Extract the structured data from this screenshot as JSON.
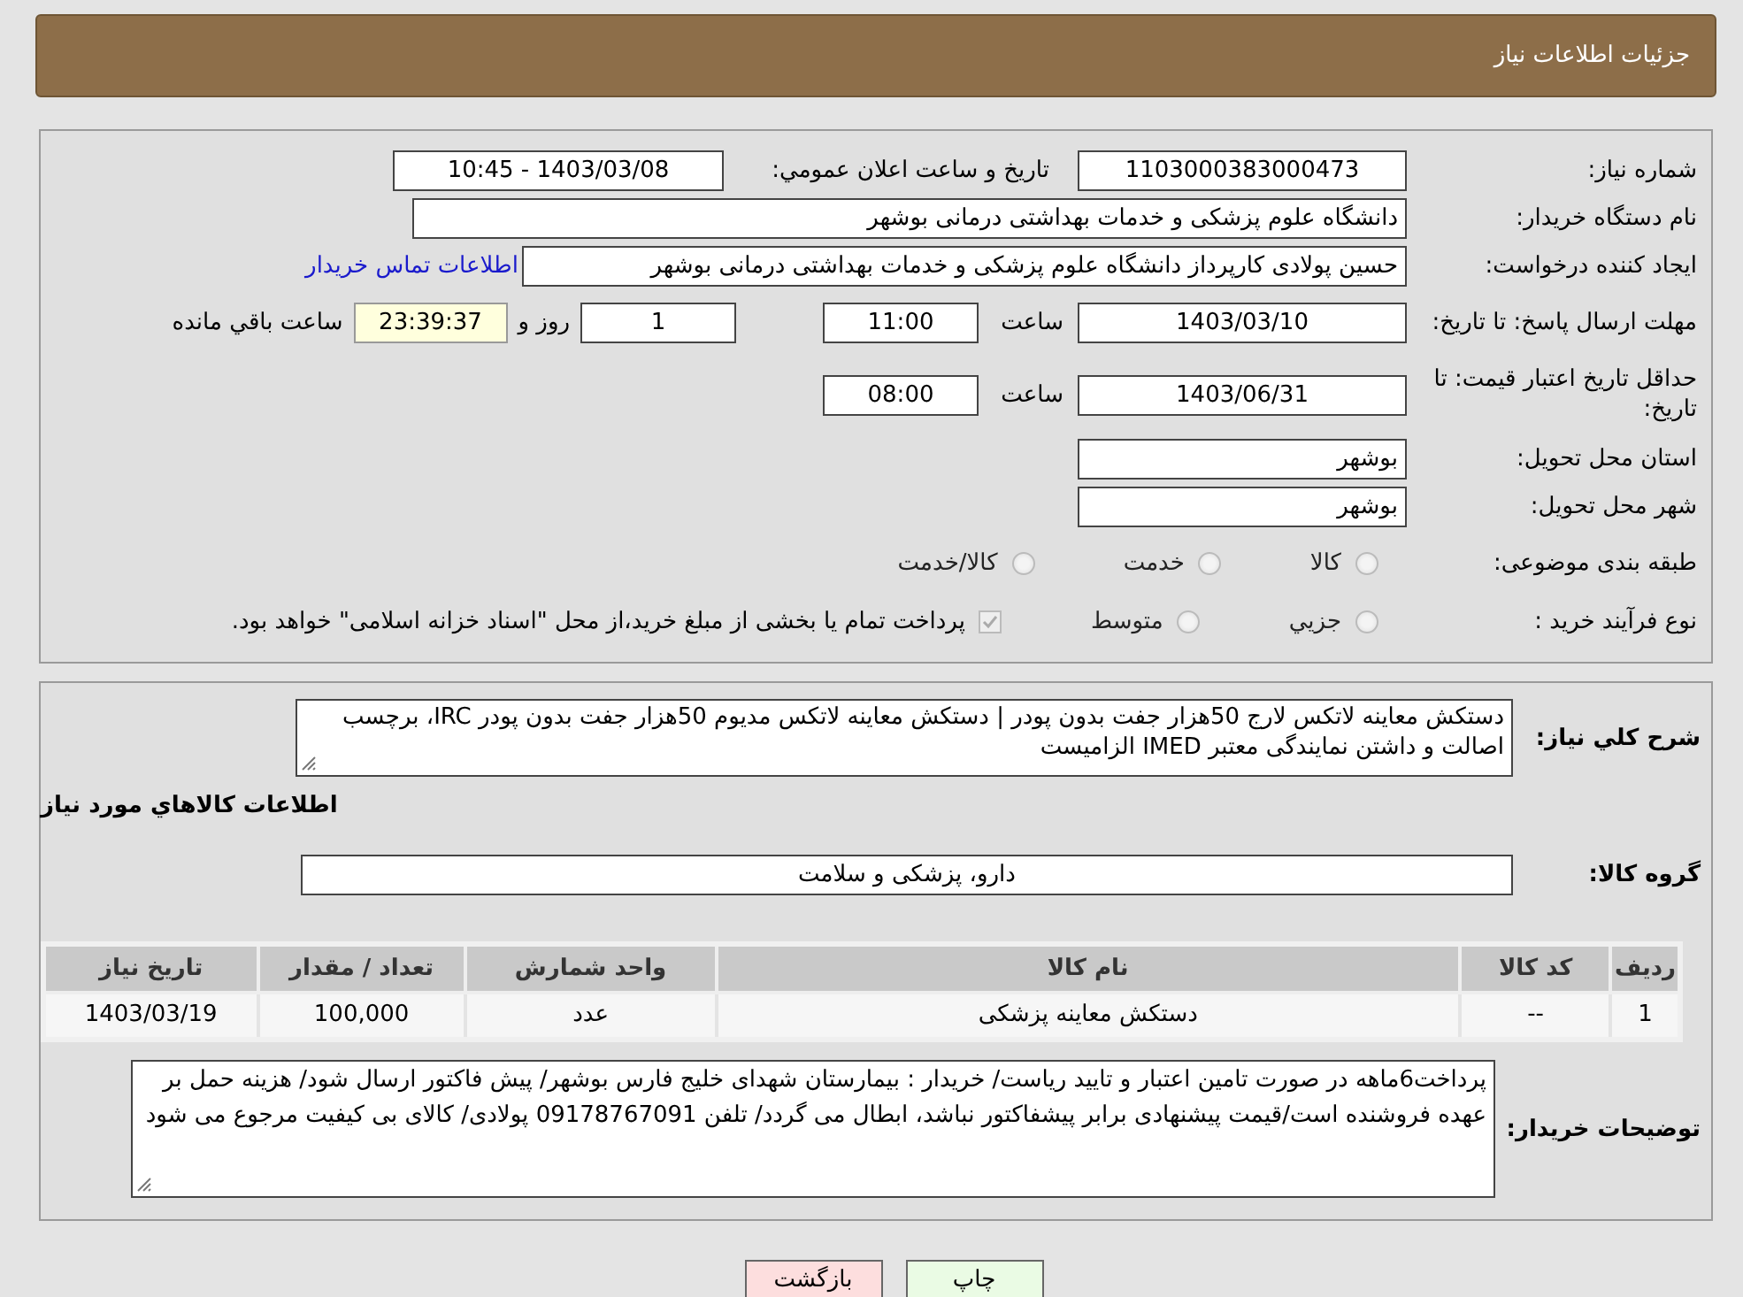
{
  "header": {
    "title": "جزئیات اطلاعات نیاز"
  },
  "details": {
    "need_number": {
      "label": "شماره نیاز:",
      "value": "1103000383000473"
    },
    "announce": {
      "label": "تاريخ و ساعت اعلان عمومي:",
      "value": "1403/03/08 - 10:45"
    },
    "buyer_org": {
      "label": "نام دستگاه خریدار:",
      "value": "دانشگاه علوم پزشکی و خدمات بهداشتی درمانی بوشهر"
    },
    "requester": {
      "label": "ایجاد کننده درخواست:",
      "value": "حسین پولادی کارپرداز دانشگاه علوم پزشکی و خدمات بهداشتی درمانی بوشهر",
      "link": "اطلاعات تماس خریدار"
    },
    "reply_deadline": {
      "label": "مهلت ارسال پاسخ: تا تاریخ:",
      "date": "1403/03/10",
      "time_label": "ساعت",
      "time": "11:00",
      "days": "1",
      "days_label": "روز و",
      "remaining": "23:39:37",
      "remaining_label": "ساعت باقي مانده"
    },
    "price_validity": {
      "label": "حداقل تاریخ اعتبار قیمت: تا تاریخ:",
      "date": "1403/06/31",
      "time_label": "ساعت",
      "time": "08:00"
    },
    "province": {
      "label": "استان محل تحویل:",
      "value": "بوشهر"
    },
    "city": {
      "label": "شهر محل تحویل:",
      "value": "بوشهر"
    },
    "category": {
      "label": "طبقه بندی موضوعی:",
      "options": [
        {
          "label": "کالا",
          "selected": false
        },
        {
          "label": "خدمت",
          "selected": false
        },
        {
          "label": "کالا/خدمت",
          "selected": false
        }
      ]
    },
    "process": {
      "label": "نوع فرآیند خرید :",
      "options": [
        {
          "label": "جزيي",
          "selected": false
        },
        {
          "label": "متوسط",
          "selected": false
        }
      ],
      "payment_note": {
        "label": "پرداخت تمام یا بخشی از مبلغ خرید،از محل \"اسناد خزانه اسلامی\" خواهد بود.",
        "checked": true
      }
    }
  },
  "items": {
    "summary": {
      "label": "شرح کلي نیاز:",
      "value": "دستکش معاینه لاتکس لارج 50هزار جفت بدون پودر | دستکش معاینه لاتکس مدیوم 50هزار جفت بدون پودر IRC، برچسب اصالت و داشتن نمایندگی معتبر IMED الزامیست"
    },
    "heading": "اطلاعات کالاهاي مورد نیاز",
    "group": {
      "label": "گروه کالا:",
      "value": "دارو، پزشکی و سلامت"
    },
    "table": {
      "columns": [
        "ردیف",
        "کد کالا",
        "نام کالا",
        "واحد شمارش",
        "تعداد / مقدار",
        "تاریخ نیاز"
      ],
      "rows": [
        [
          "1",
          "--",
          "دستکش معاینه پزشکی",
          "عدد",
          "100,000",
          "1403/03/19"
        ]
      ]
    },
    "notes": {
      "label": "توضیحات خریدار:",
      "value": "پرداخت6ماهه در صورت تامین اعتبار و تایید ریاست/ خریدار : بیمارستان شهدای خلیج فارس بوشهر/ پیش فاکتور ارسال شود/ هزینه حمل بر عهده فروشنده است/قیمت پیشنهادی برابر پیشفاکتور نباشد، ابطال می گردد/ تلفن 09178767091 پولادی/ کالای بی کیفیت مرجوع می شود"
    }
  },
  "buttons": [
    {
      "label": "چاپ",
      "kind": "print"
    },
    {
      "label": "بازگشت",
      "kind": "back"
    }
  ]
}
